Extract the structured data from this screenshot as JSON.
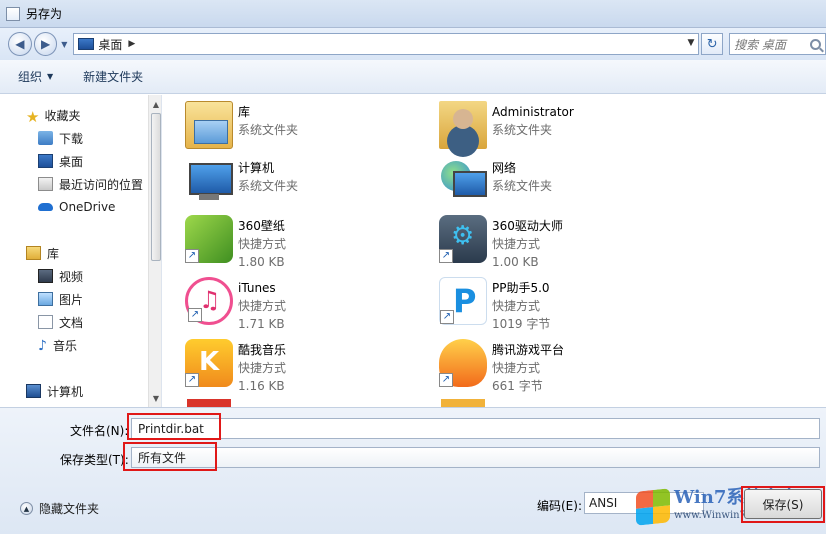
{
  "window": {
    "title": "另存为"
  },
  "address": {
    "location": "桌面",
    "search_placeholder": "搜索 桌面"
  },
  "toolbar": {
    "organize": "组织",
    "new_folder": "新建文件夹"
  },
  "sidebar": {
    "favorites": "收藏夹",
    "items": [
      {
        "label": "下载"
      },
      {
        "label": "桌面"
      },
      {
        "label": "最近访问的位置"
      },
      {
        "label": "OneDrive"
      }
    ],
    "libraries": "库",
    "library_items": [
      {
        "label": "视频"
      },
      {
        "label": "图片"
      },
      {
        "label": "文档"
      },
      {
        "label": "音乐"
      }
    ],
    "computer": "计算机"
  },
  "files": [
    {
      "name": "库",
      "type": "系统文件夹",
      "size": ""
    },
    {
      "name": "Administrator",
      "type": "系统文件夹",
      "size": ""
    },
    {
      "name": "计算机",
      "type": "系统文件夹",
      "size": ""
    },
    {
      "name": "网络",
      "type": "系统文件夹",
      "size": ""
    },
    {
      "name": "360壁纸",
      "type": "快捷方式",
      "size": "1.80 KB"
    },
    {
      "name": "360驱动大师",
      "type": "快捷方式",
      "size": "1.00 KB"
    },
    {
      "name": "iTunes",
      "type": "快捷方式",
      "size": "1.71 KB"
    },
    {
      "name": "PP助手5.0",
      "type": "快捷方式",
      "size": "1019 字节"
    },
    {
      "name": "酷我音乐",
      "type": "快捷方式",
      "size": "1.16 KB"
    },
    {
      "name": "腾讯游戏平台",
      "type": "快捷方式",
      "size": "661 字节"
    }
  ],
  "form": {
    "filename_label": "文件名(N):",
    "filename_value": "Printdir.bat",
    "filetype_label": "保存类型(T):",
    "filetype_value": "所有文件",
    "hide_folders": "隐藏文件夹",
    "encoding_label": "编码(E):",
    "encoding_value": "ANSI",
    "save_button": "保存(S)"
  },
  "watermark": {
    "brand": "Win7系统之家",
    "url": "www.Winwin7.com"
  }
}
